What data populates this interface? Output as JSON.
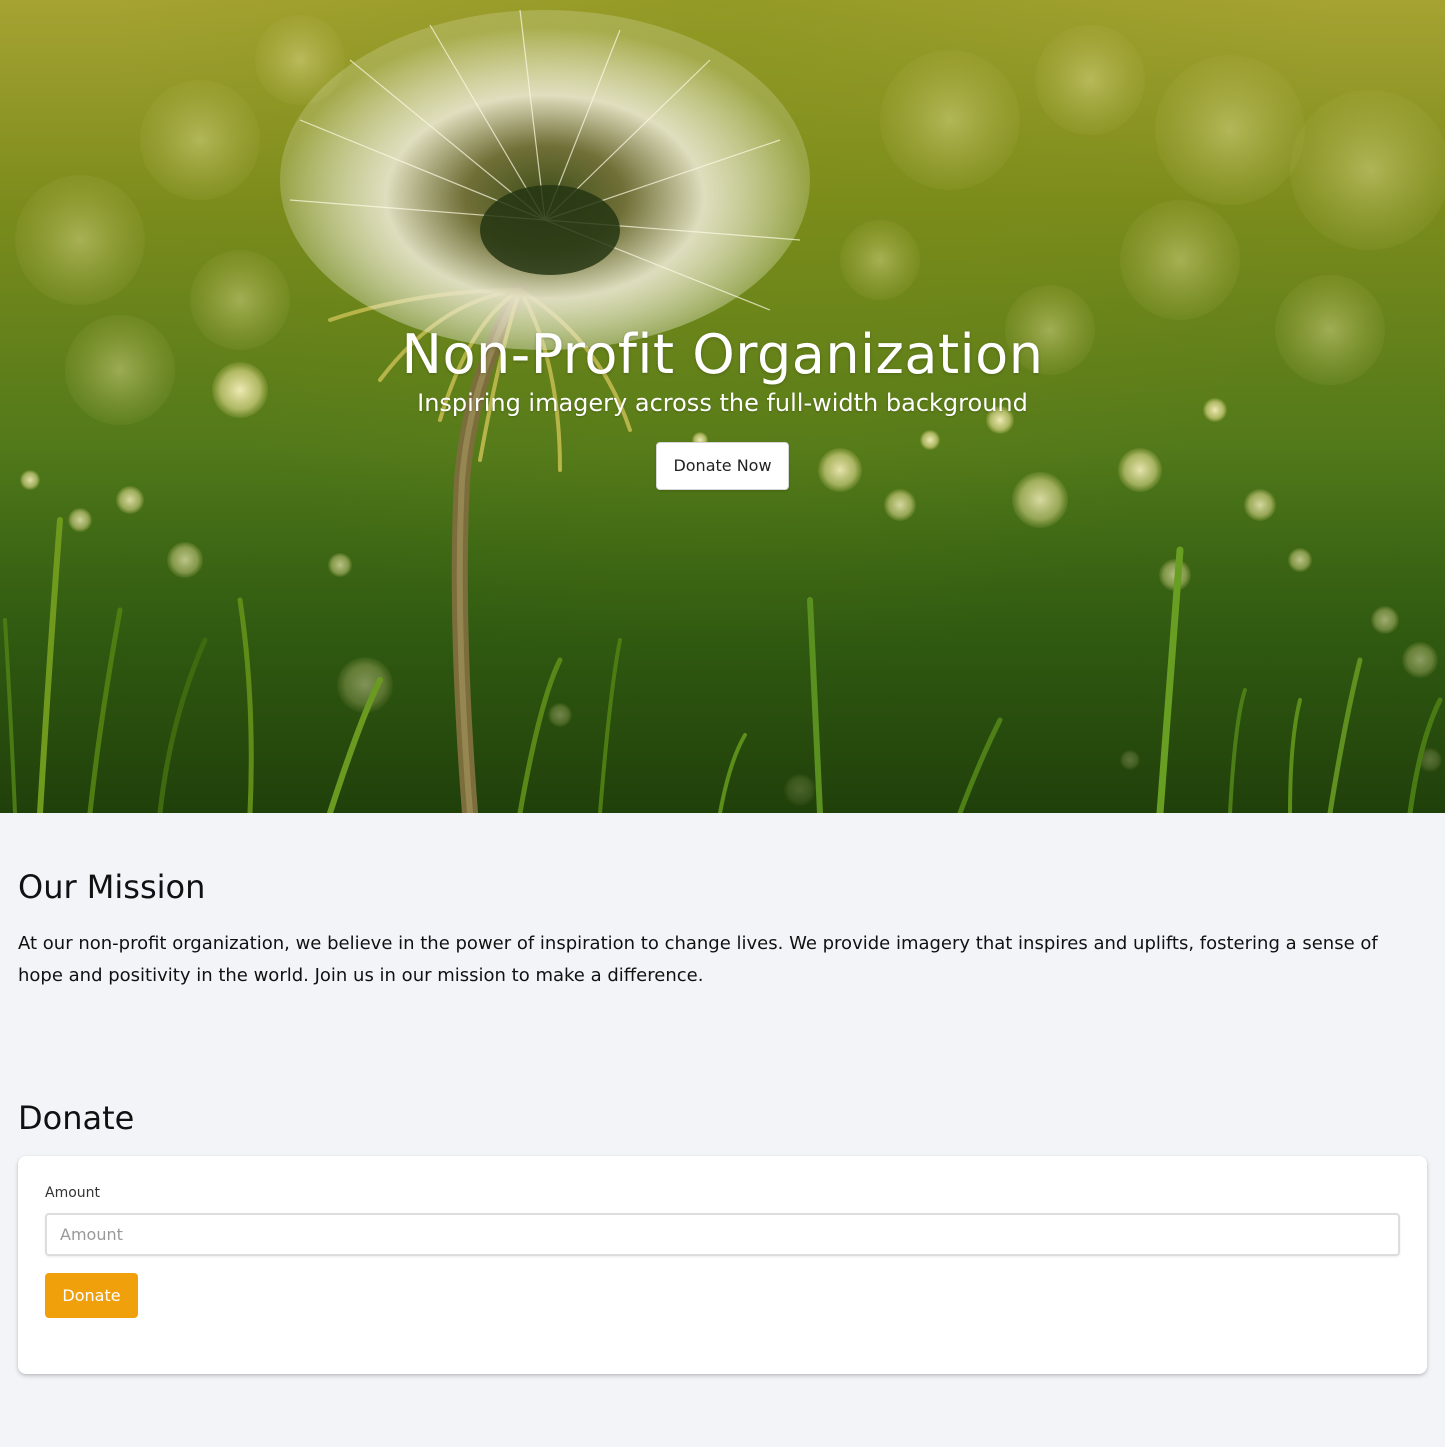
{
  "hero": {
    "title": "Non-Profit Organization",
    "subtitle": "Inspiring imagery across the full-width background",
    "button_label": "Donate Now"
  },
  "mission": {
    "title": "Our Mission",
    "text": "At our non-profit organization, we believe in the power of inspiration to change lives. We provide imagery that inspires and uplifts, fostering a sense of hope and positivity in the world. Join us in our mission to make a difference."
  },
  "donate": {
    "title": "Donate",
    "amount_label": "Amount",
    "amount_value": "",
    "amount_placeholder": "Amount",
    "button_label": "Donate"
  },
  "colors": {
    "page_background": "#f3f4f7",
    "accent": "#f0a00a",
    "card_background": "#ffffff"
  }
}
